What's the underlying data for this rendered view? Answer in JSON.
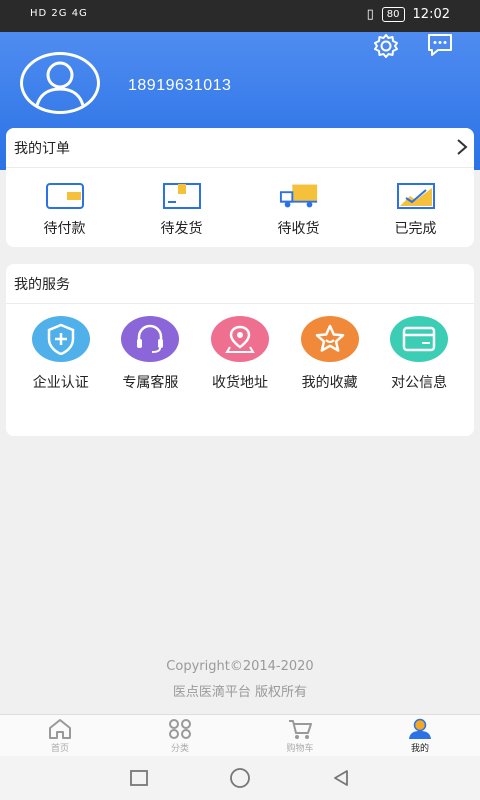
{
  "status": {
    "network": "HD 2G 4G",
    "battery": "80",
    "time": "12:02"
  },
  "profile": {
    "phone": "18919631013"
  },
  "orders": {
    "title": "我的订单",
    "items": [
      {
        "label": "待付款",
        "icon": "wallet-icon"
      },
      {
        "label": "待发货",
        "icon": "box-icon"
      },
      {
        "label": "待收货",
        "icon": "truck-icon"
      },
      {
        "label": "已完成",
        "icon": "chart-check-icon"
      }
    ]
  },
  "services": {
    "title": "我的服务",
    "items": [
      {
        "label": "企业认证",
        "icon": "shield-plus-icon",
        "color": "#4fb0ea"
      },
      {
        "label": "专属客服",
        "icon": "headset-icon",
        "color": "#8b66d8"
      },
      {
        "label": "收货地址",
        "icon": "location-pin-icon",
        "color": "#ef6f90"
      },
      {
        "label": "我的收藏",
        "icon": "star-icon",
        "color": "#f08a3a"
      },
      {
        "label": "对公信息",
        "icon": "card-icon",
        "color": "#3ccdb5"
      }
    ]
  },
  "footer": {
    "copyright": "Copyright©2014-2020",
    "company": "医点医滴平台 版权所有"
  },
  "tabs": [
    {
      "label": "首页"
    },
    {
      "label": "分类"
    },
    {
      "label": "购物车"
    },
    {
      "label": "我的"
    }
  ],
  "colors": {
    "header": "#2a72e6",
    "accent": "#4f8cf0"
  }
}
